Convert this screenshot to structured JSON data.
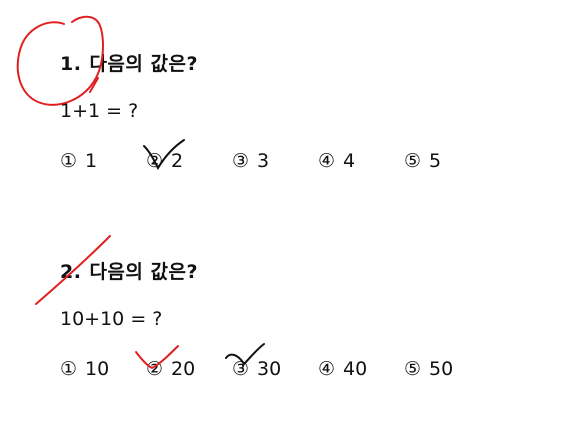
{
  "questions": [
    {
      "number": "1.",
      "title": "다음의 값은?",
      "expression": "1+1 = ?",
      "choices": [
        {
          "mark": "①",
          "value": "1"
        },
        {
          "mark": "②",
          "value": "2"
        },
        {
          "mark": "③",
          "value": "3"
        },
        {
          "mark": "④",
          "value": "4"
        },
        {
          "mark": "⑤",
          "value": "5"
        }
      ]
    },
    {
      "number": "2.",
      "title": "다음의 값은?",
      "expression": "10+10 = ?",
      "choices": [
        {
          "mark": "①",
          "value": "10"
        },
        {
          "mark": "②",
          "value": "20"
        },
        {
          "mark": "③",
          "value": "30"
        },
        {
          "mark": "④",
          "value": "40"
        },
        {
          "mark": "⑤",
          "value": "50"
        }
      ]
    }
  ],
  "annotations": {
    "red_color": "#e02020",
    "black_color": "#111111"
  }
}
